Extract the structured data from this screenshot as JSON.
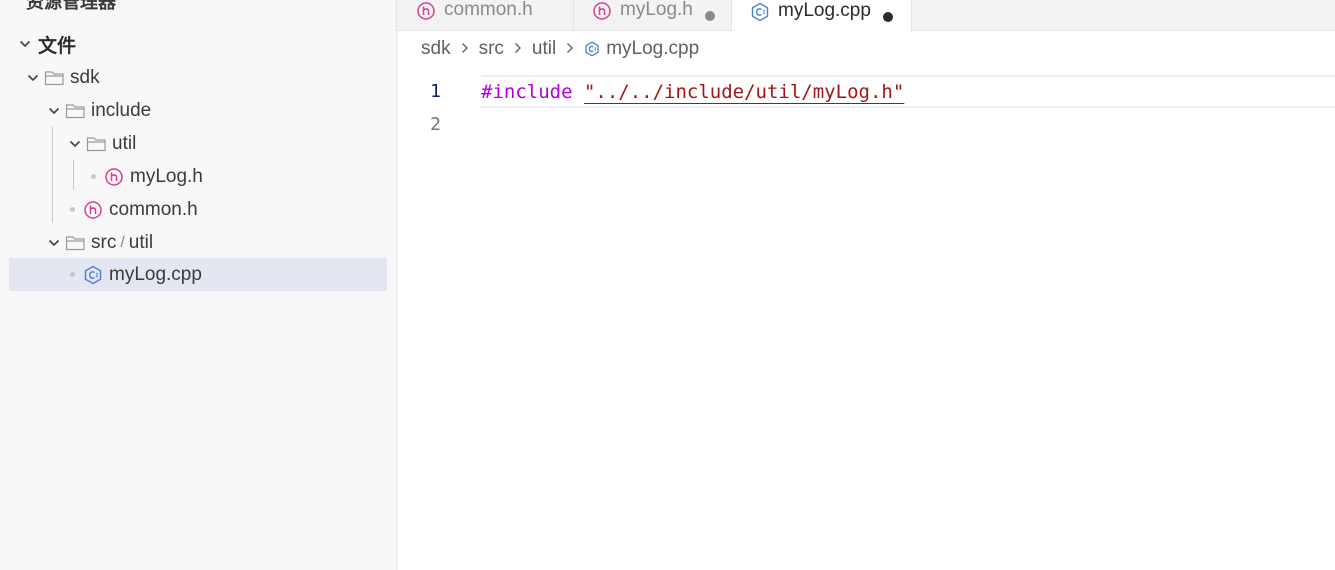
{
  "sidebar": {
    "title": "资源管理器",
    "more_label": "···",
    "section": "文件",
    "tree": {
      "sdk": "sdk",
      "include": "include",
      "util": "util",
      "mylog_h": "myLog.h",
      "common_h": "common.h",
      "src": "src",
      "src_util_sep": "/",
      "src_util": "util",
      "mylog_cpp": "myLog.cpp"
    }
  },
  "tabs": [
    {
      "label": "common.h",
      "icon": "header-file-icon",
      "dirty": false
    },
    {
      "label": "myLog.h",
      "icon": "header-file-icon",
      "dirty": true
    },
    {
      "label": "myLog.cpp",
      "icon": "cpp-file-icon",
      "dirty": true,
      "active": true
    }
  ],
  "breadcrumb": [
    "sdk",
    "src",
    "util",
    "myLog.cpp"
  ],
  "editor": {
    "lines": [
      {
        "number": "1",
        "keyword": "#include",
        "string": "\"../../include/util/myLog.h\""
      },
      {
        "number": "2",
        "keyword": "",
        "string": ""
      }
    ]
  },
  "colors": {
    "header_icon": "#d63f8e",
    "cpp_icon": "#4b7ed6",
    "keyword": "#af00db",
    "string": "#a31515",
    "selected_row": "#e4e6f1"
  }
}
